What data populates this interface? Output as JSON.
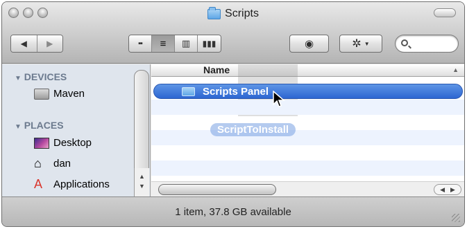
{
  "window": {
    "title": "Scripts",
    "colors": {
      "selection": "#3a73d9",
      "sidebar_bg": "#dfe5ed",
      "sidebar_heading": "#6c7a8e"
    }
  },
  "toolbar": {
    "back_icon": "back-arrow-icon",
    "forward_icon": "forward-arrow-icon",
    "view_modes": [
      "icon-view-icon",
      "list-view-icon",
      "column-view-icon",
      "coverflow-view-icon"
    ],
    "active_view": "list-view-icon",
    "quicklook_icon": "eye-icon",
    "action_icon": "gear-icon",
    "search_placeholder": ""
  },
  "sidebar": {
    "sections": [
      {
        "heading": "DEVICES",
        "items": [
          {
            "label": "Maven",
            "icon": "hard-drive-icon"
          }
        ]
      },
      {
        "heading": "PLACES",
        "items": [
          {
            "label": "Desktop",
            "icon": "desktop-icon"
          },
          {
            "label": "dan",
            "icon": "home-icon"
          },
          {
            "label": "Applications",
            "icon": "applications-icon"
          }
        ]
      }
    ]
  },
  "list": {
    "column_header": "Name",
    "rows": [
      {
        "label": "Scripts Panel",
        "icon": "folder-icon",
        "selected": true
      }
    ],
    "drag_item": "ScriptToInstall"
  },
  "status": {
    "text": "1 item, 37.8 GB available"
  }
}
